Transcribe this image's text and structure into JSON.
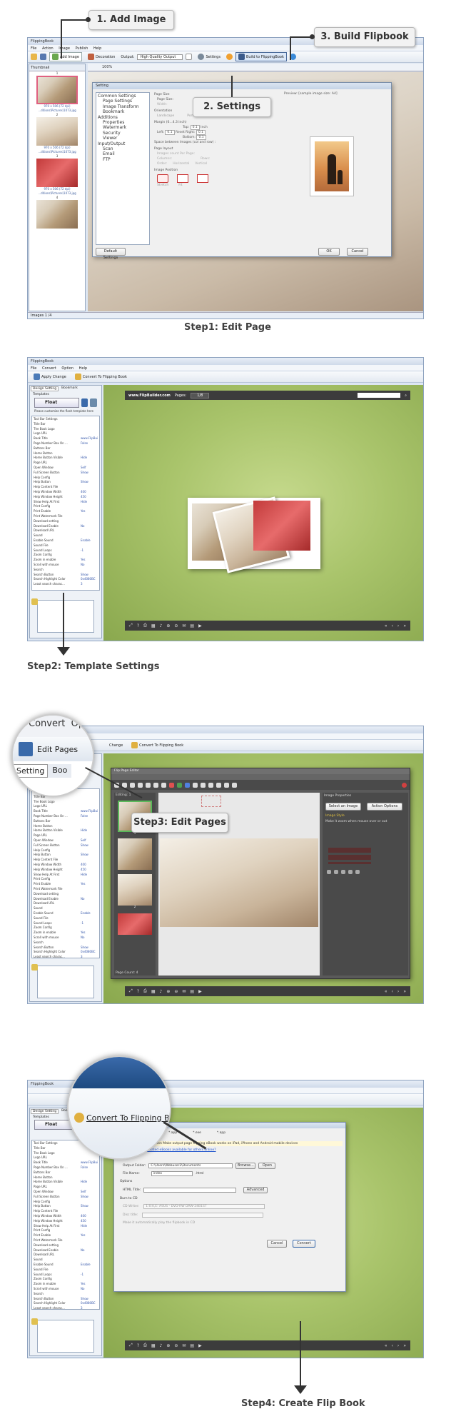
{
  "step1": {
    "window_title": "FlippingBook",
    "menu": [
      "File",
      "Action",
      "Image",
      "Publish",
      "Help"
    ],
    "toolbar": {
      "add_image": "Add Image",
      "decoration": "Decoration",
      "output_label": "Output:",
      "output_value": "High Quality Output",
      "settings": "Settings",
      "build": "Build to FlippingBook"
    },
    "thumbnail_tab": "Thumbnail",
    "thumbs": [
      {
        "num": "1",
        "info": "970 x 506 (72 dpi)",
        "path": "...ditions\\Pictures\\1073.jpg"
      },
      {
        "num": "2",
        "info": "970 x 506 (72 dpi)",
        "path": "...ditions\\Pictures\\1073.jpg"
      },
      {
        "num": "3",
        "info": "970 x 506 (72 dpi)",
        "path": "...ditions\\Pictures\\1073.jpg"
      },
      {
        "num": "4",
        "info": "",
        "path": ""
      }
    ],
    "status": "Images 1 /4",
    "zoom": "100%",
    "dialog": {
      "title": "Setting",
      "tree": [
        "Common Settings",
        "Page Settings",
        "Image Transform",
        "Bookmark",
        "Additions",
        "Properties",
        "Watermark",
        "Security",
        "Viewer",
        "Input/Output",
        "Scan",
        "Email",
        "FTP"
      ],
      "page_size": "Page Size",
      "page_size_label": "Page Size:",
      "width_label": "Width:",
      "orientation": "Orientation",
      "landscape": "Landscape",
      "portrait": "Portrait",
      "margin": "Margin (0...4.3 inch)",
      "top_label": "Top:",
      "left_label": "Left:",
      "right_label": "Right:",
      "bottom_label": "Bottom:",
      "reset": "Reset",
      "margin_val": "0.1",
      "unit": "Inch",
      "space": "Space between Images (col and row) :",
      "layout": "Page layout",
      "images_per_page": "Images count Per Page:",
      "columns": "Columns:",
      "rows": "Rows:",
      "order": "Order:",
      "horizontal": "Horizontal",
      "vertical": "Vertical",
      "image_position": "Image Position",
      "stretch": "Stretch",
      "fit": "Fit",
      "preview": "Preview: [sample image size: A4]",
      "default_settings": "Default Settings",
      "ok": "OK",
      "cancel": "Cancel"
    },
    "callout1": "1. Add Image",
    "callout2": "2. Settings",
    "callout3": "3. Build Flipbook",
    "caption": "Step1: Edit Page"
  },
  "step2": {
    "window_title": "FlippingBook",
    "menu": [
      "File",
      "Convert",
      "Option",
      "Help"
    ],
    "apply_change": "Apply Change",
    "convert": "Convert To Flipping Book",
    "tabs": [
      "Design Setting",
      "Bookmark"
    ],
    "templates": "Templates",
    "template_name": "Float",
    "customize": "Please customize the flash template here",
    "site": "www.FlipBuilder.com",
    "pages_label": "Pages:",
    "page_value": "1/8",
    "caption": "Step2: Template Settings"
  },
  "tree_items": [
    [
      "Tool Bar Settings",
      ""
    ],
    [
      "Title Bar",
      ""
    ],
    [
      "The Book Logo",
      ""
    ],
    [
      "Logo URL",
      ""
    ],
    [
      "Book Title",
      "www.FlipBuil..."
    ],
    [
      "Page Number Box On ...",
      "False"
    ],
    [
      "Buttons Bar",
      ""
    ],
    [
      "Home Button",
      ""
    ],
    [
      "Home Button Visible",
      "Hide"
    ],
    [
      "Page URL",
      ""
    ],
    [
      "Open Window",
      "Self"
    ],
    [
      "Full Screen Button",
      "Show"
    ],
    [
      "Help Config",
      ""
    ],
    [
      "Help Button",
      "Show"
    ],
    [
      "Help Content File",
      ""
    ],
    [
      "Help Window Width",
      "400"
    ],
    [
      "Help Window Height",
      "450"
    ],
    [
      "Show Help At First",
      "Hide"
    ],
    [
      "Print Config",
      ""
    ],
    [
      "Print Enable",
      "Yes"
    ],
    [
      "Print Watermark File",
      ""
    ],
    [
      "Download setting",
      ""
    ],
    [
      "Download Enable",
      "No"
    ],
    [
      "Download URL",
      ""
    ],
    [
      "Sound",
      ""
    ],
    [
      "Enable Sound",
      "Enable"
    ],
    [
      "Sound File",
      ""
    ],
    [
      "Sound Loops",
      "-1"
    ],
    [
      "Zoom Config",
      ""
    ],
    [
      "Zoom in enable",
      "Yes"
    ],
    [
      "Scroll with mouse",
      "No"
    ],
    [
      "Search",
      ""
    ],
    [
      "Search Button",
      "Show"
    ],
    [
      "Search Highlight Color",
      "0x4080BC"
    ],
    [
      "Least search charac...",
      "3"
    ]
  ],
  "step3": {
    "convert_partial": "Convert",
    "option_partial": "Op",
    "edit_pages": "Edit Pages",
    "setting_partial": "Setting",
    "boo_partial": "Boo",
    "change": "Change",
    "convert_btn": "Convert To Flipping Book",
    "editor_title": "Flip Page Editor",
    "editing": "Editing: 1",
    "page_count": "Page Count: 4",
    "image_props": "Image Properties",
    "select_image": "Select an Image",
    "action_options": "Action Options",
    "image_style": "Image Style",
    "hover_zoom": "Make it zoom when mouse over or out",
    "callout": "Step3: Edit Pages",
    "thumb_nums": [
      "1",
      "2"
    ]
  },
  "step4": {
    "zoom_label": "Convert To Flipping Book",
    "output_types": [
      "*.html",
      "*.zip",
      "*.app",
      "*.exe",
      "*.app"
    ],
    "mobile": "Also Make Mobile Version",
    "mobile_desc": "Make output page flipping eBook works on iPad, iPhone and Android mobile devices",
    "how_to": "How to make created eBooks available for others online?",
    "path": "Path",
    "output_folder": "Output Folder:",
    "folder_value": "C:\\Users\\Webuser2\\Documents",
    "browse": "Browse...",
    "open": "Open",
    "file_name": "File Name:",
    "file_value": "index",
    "file_ext": ".html",
    "options": "Options",
    "html_title": "HTML Title:",
    "advanced": "Advanced",
    "burn_cd": "Burn to CD",
    "cd_writer": "CD Writer:",
    "cd_value": "1:0:0,E: ASUS - DVD-RW DRW-24B1ST",
    "disc_title": "Disc title:",
    "autoplay": "Make it automatically play the flipbook in CD",
    "cancel": "Cancel",
    "convert": "Convert",
    "caption": "Step4: Create Flip Book"
  }
}
